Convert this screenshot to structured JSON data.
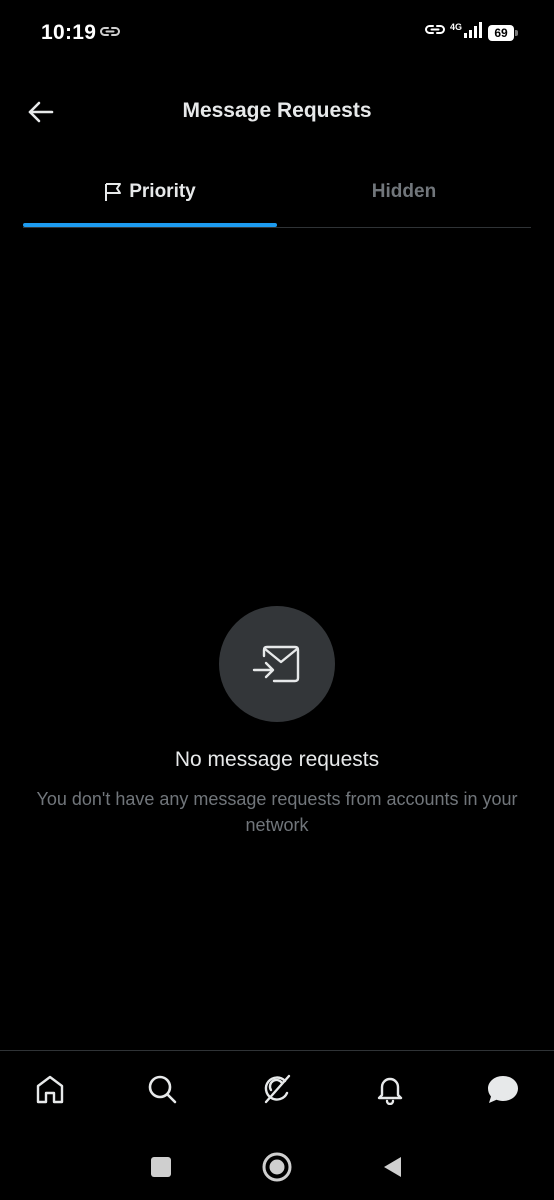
{
  "status_bar": {
    "time": "10:19",
    "network": "4G",
    "battery": "69"
  },
  "header": {
    "title": "Message Requests",
    "back_icon": "arrow-left-icon"
  },
  "tabs": [
    {
      "label": "Priority",
      "icon": "flag-icon",
      "active": true
    },
    {
      "label": "Hidden",
      "active": false
    }
  ],
  "empty_state": {
    "icon": "message-request-icon",
    "title": "No message requests",
    "subtitle": "You don't have any message requests from accounts in your network"
  },
  "bottom_nav": [
    {
      "name": "home",
      "icon": "home-icon"
    },
    {
      "name": "search",
      "icon": "search-icon"
    },
    {
      "name": "grok",
      "icon": "grok-icon"
    },
    {
      "name": "notifications",
      "icon": "bell-icon"
    },
    {
      "name": "messages",
      "icon": "message-bubble-icon",
      "active": true
    }
  ],
  "system_nav": [
    {
      "name": "recents",
      "icon": "square-icon"
    },
    {
      "name": "home",
      "icon": "circle-icon"
    },
    {
      "name": "back",
      "icon": "triangle-back-icon"
    }
  ],
  "colors": {
    "background": "#000000",
    "accent": "#1d9bf0",
    "text_primary": "#e7e9ea",
    "text_secondary": "#71767b",
    "divider": "#2f3336",
    "icon_circle": "#333639"
  }
}
